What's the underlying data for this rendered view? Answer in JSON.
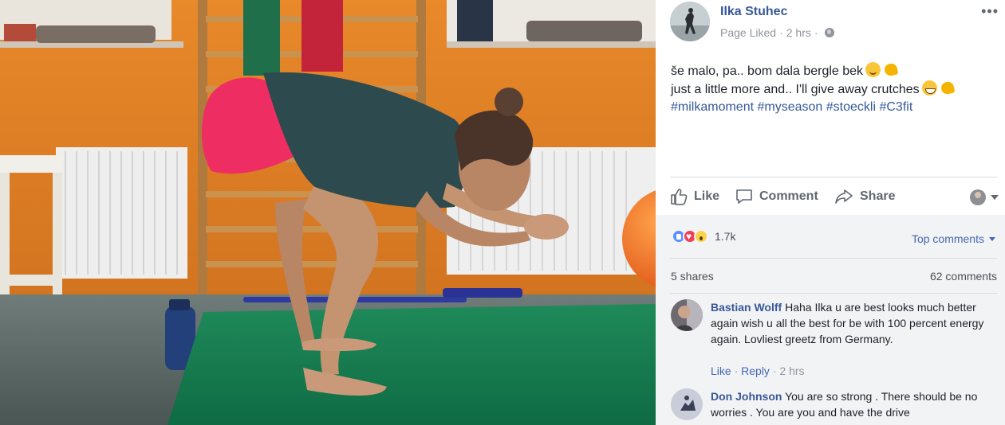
{
  "post": {
    "author": "Ilka Stuhec",
    "meta_status": "Page Liked",
    "meta_dot": "·",
    "meta_time": "2 hrs",
    "meta_dot2": "·",
    "more_label": "•••",
    "text_line1": "še malo, pa.. bom dala bergle bek",
    "text_line2": "just a little more and.. I'll give away crutches",
    "hashtags": [
      "#milkamoment",
      "#myseason",
      "#stoeckli",
      "#C3fit"
    ]
  },
  "actions": {
    "like": "Like",
    "comment": "Comment",
    "share": "Share"
  },
  "stats": {
    "reactions": "1.7k",
    "top_comments": "Top comments",
    "shares": "5 shares",
    "comments": "62 comments"
  },
  "comments": [
    {
      "name": "Bastian Wolff",
      "text": "Haha Ilka u are best looks much better again wish u all the best for be with 100 percent energy again. Lovliest greetz from Germany.",
      "like": "Like",
      "reply": "Reply",
      "sep": "·",
      "time": "2 hrs"
    },
    {
      "name": "Don Johnson",
      "text": "You are so strong . There should be no worries . You are you and have the drive"
    }
  ],
  "colors": {
    "link_blue": "#385898",
    "accent_blue": "#4267b2",
    "muted": "#90949c",
    "panel_bg": "#f2f3f5"
  }
}
